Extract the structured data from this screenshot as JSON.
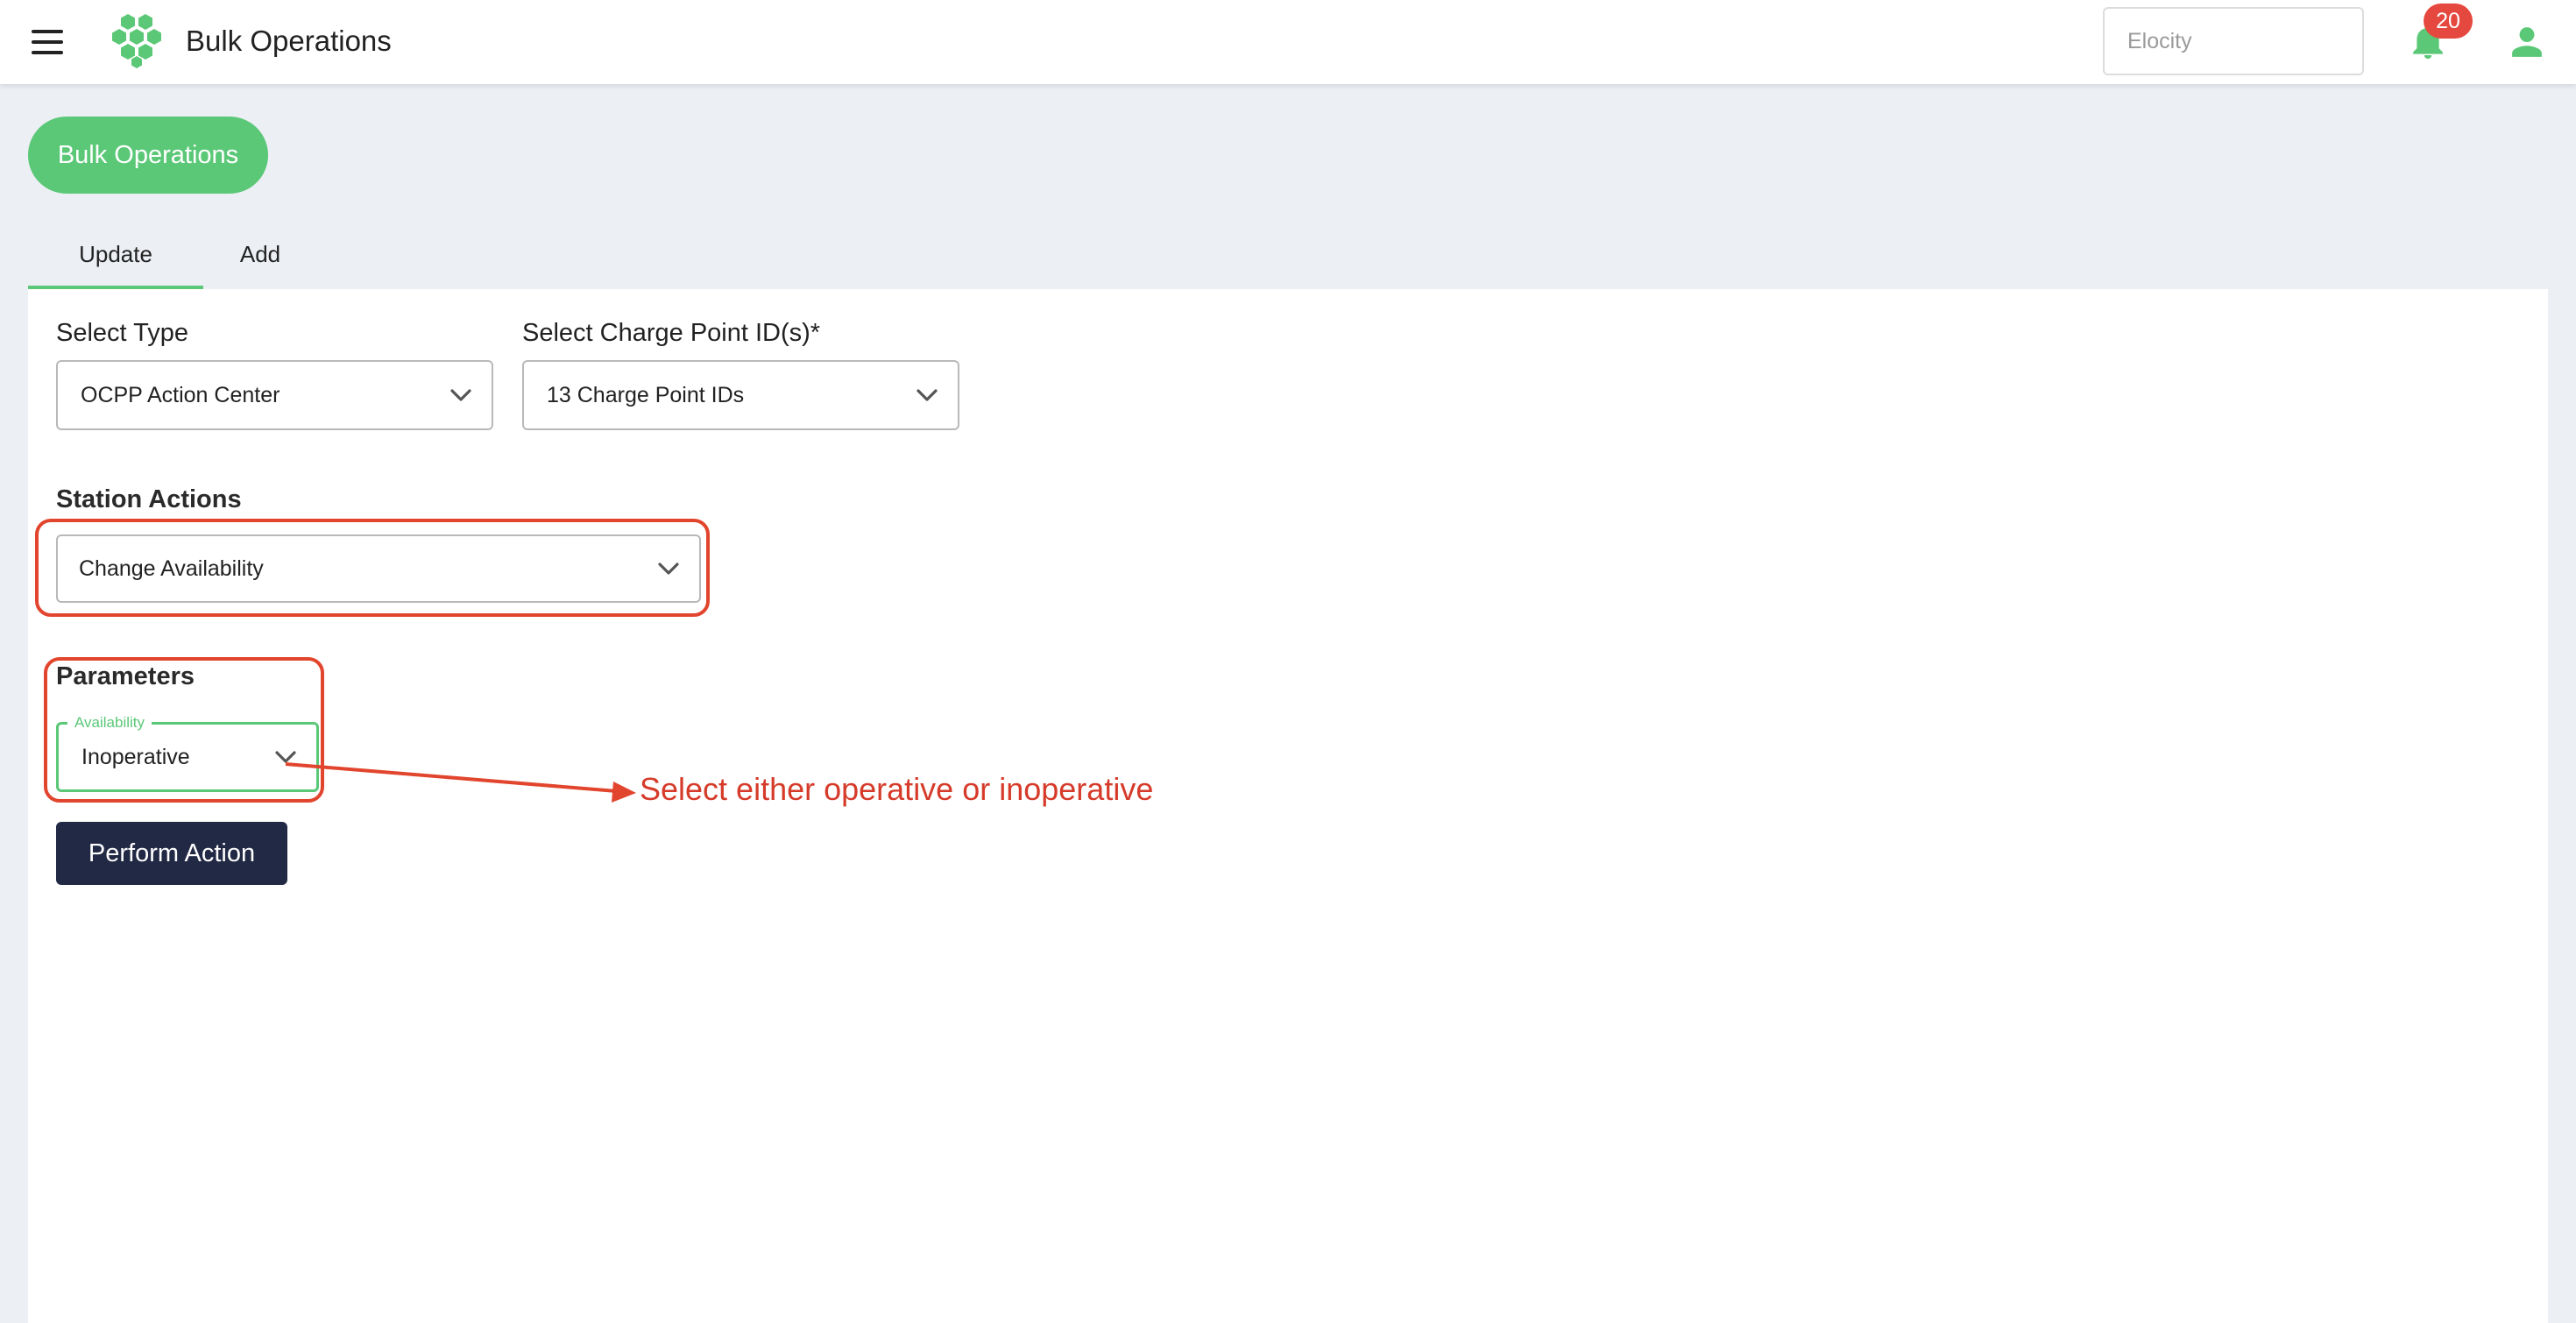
{
  "header": {
    "title": "Bulk Operations",
    "org_placeholder": "Elocity",
    "notification_count": "20"
  },
  "page": {
    "header_button": "Bulk Operations",
    "tabs": [
      {
        "label": "Update",
        "active": true
      },
      {
        "label": "Add",
        "active": false
      }
    ]
  },
  "form": {
    "select_type_label": "Select Type",
    "select_type_value": "OCPP Action Center",
    "charge_points_label": "Select Charge Point ID(s)*",
    "charge_points_value": "13 Charge Point IDs",
    "station_actions_label": "Station Actions",
    "station_action_value": "Change Availability",
    "parameters_label": "Parameters",
    "availability_label": "Availability",
    "availability_value": "Inoperative",
    "perform_button": "Perform Action"
  },
  "annotation": {
    "text": "Select either operative or inoperative",
    "color": "#e2452d"
  },
  "colors": {
    "accent_green": "#5bc877",
    "dark_button": "#222944",
    "badge_red": "#e5483e"
  },
  "icons": [
    "menu-icon",
    "app-logo-icon",
    "bell-icon",
    "user-icon",
    "chevron-down-icon"
  ]
}
